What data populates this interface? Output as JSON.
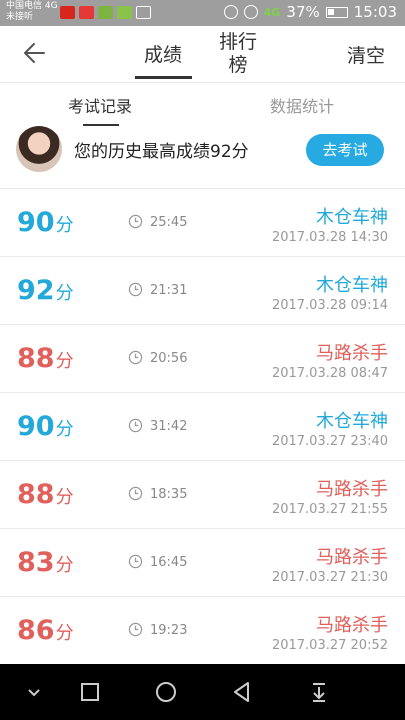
{
  "statusbar": {
    "carrier": "中国电信 4G",
    "carrier2": "未接听",
    "network": "4G",
    "battery": "37%",
    "time": "15:03"
  },
  "header": {
    "tab_score": "成绩",
    "tab_rank": "排行榜",
    "clear": "清空"
  },
  "subtabs": {
    "records": "考试记录",
    "stats": "数据统计"
  },
  "best": {
    "text": "您的历史最高成绩92分",
    "button": "去考试"
  },
  "colors": {
    "blue": "#22a9d9",
    "red": "#e0605c",
    "accent_button": "#27a9e1"
  },
  "records": [
    {
      "score": "90",
      "unit": "分",
      "duration": "25:45",
      "level": "木仓车神",
      "datetime": "2017.03.28  14:30",
      "tone": "blue"
    },
    {
      "score": "92",
      "unit": "分",
      "duration": "21:31",
      "level": "木仓车神",
      "datetime": "2017.03.28  09:14",
      "tone": "blue"
    },
    {
      "score": "88",
      "unit": "分",
      "duration": "20:56",
      "level": "马路杀手",
      "datetime": "2017.03.28  08:47",
      "tone": "red"
    },
    {
      "score": "90",
      "unit": "分",
      "duration": "31:42",
      "level": "木仓车神",
      "datetime": "2017.03.27  23:40",
      "tone": "blue"
    },
    {
      "score": "88",
      "unit": "分",
      "duration": "18:35",
      "level": "马路杀手",
      "datetime": "2017.03.27  21:55",
      "tone": "red"
    },
    {
      "score": "83",
      "unit": "分",
      "duration": "16:45",
      "level": "马路杀手",
      "datetime": "2017.03.27  21:30",
      "tone": "red"
    },
    {
      "score": "86",
      "unit": "分",
      "duration": "19:23",
      "level": "马路杀手",
      "datetime": "2017.03.27  20:52",
      "tone": "red"
    }
  ]
}
